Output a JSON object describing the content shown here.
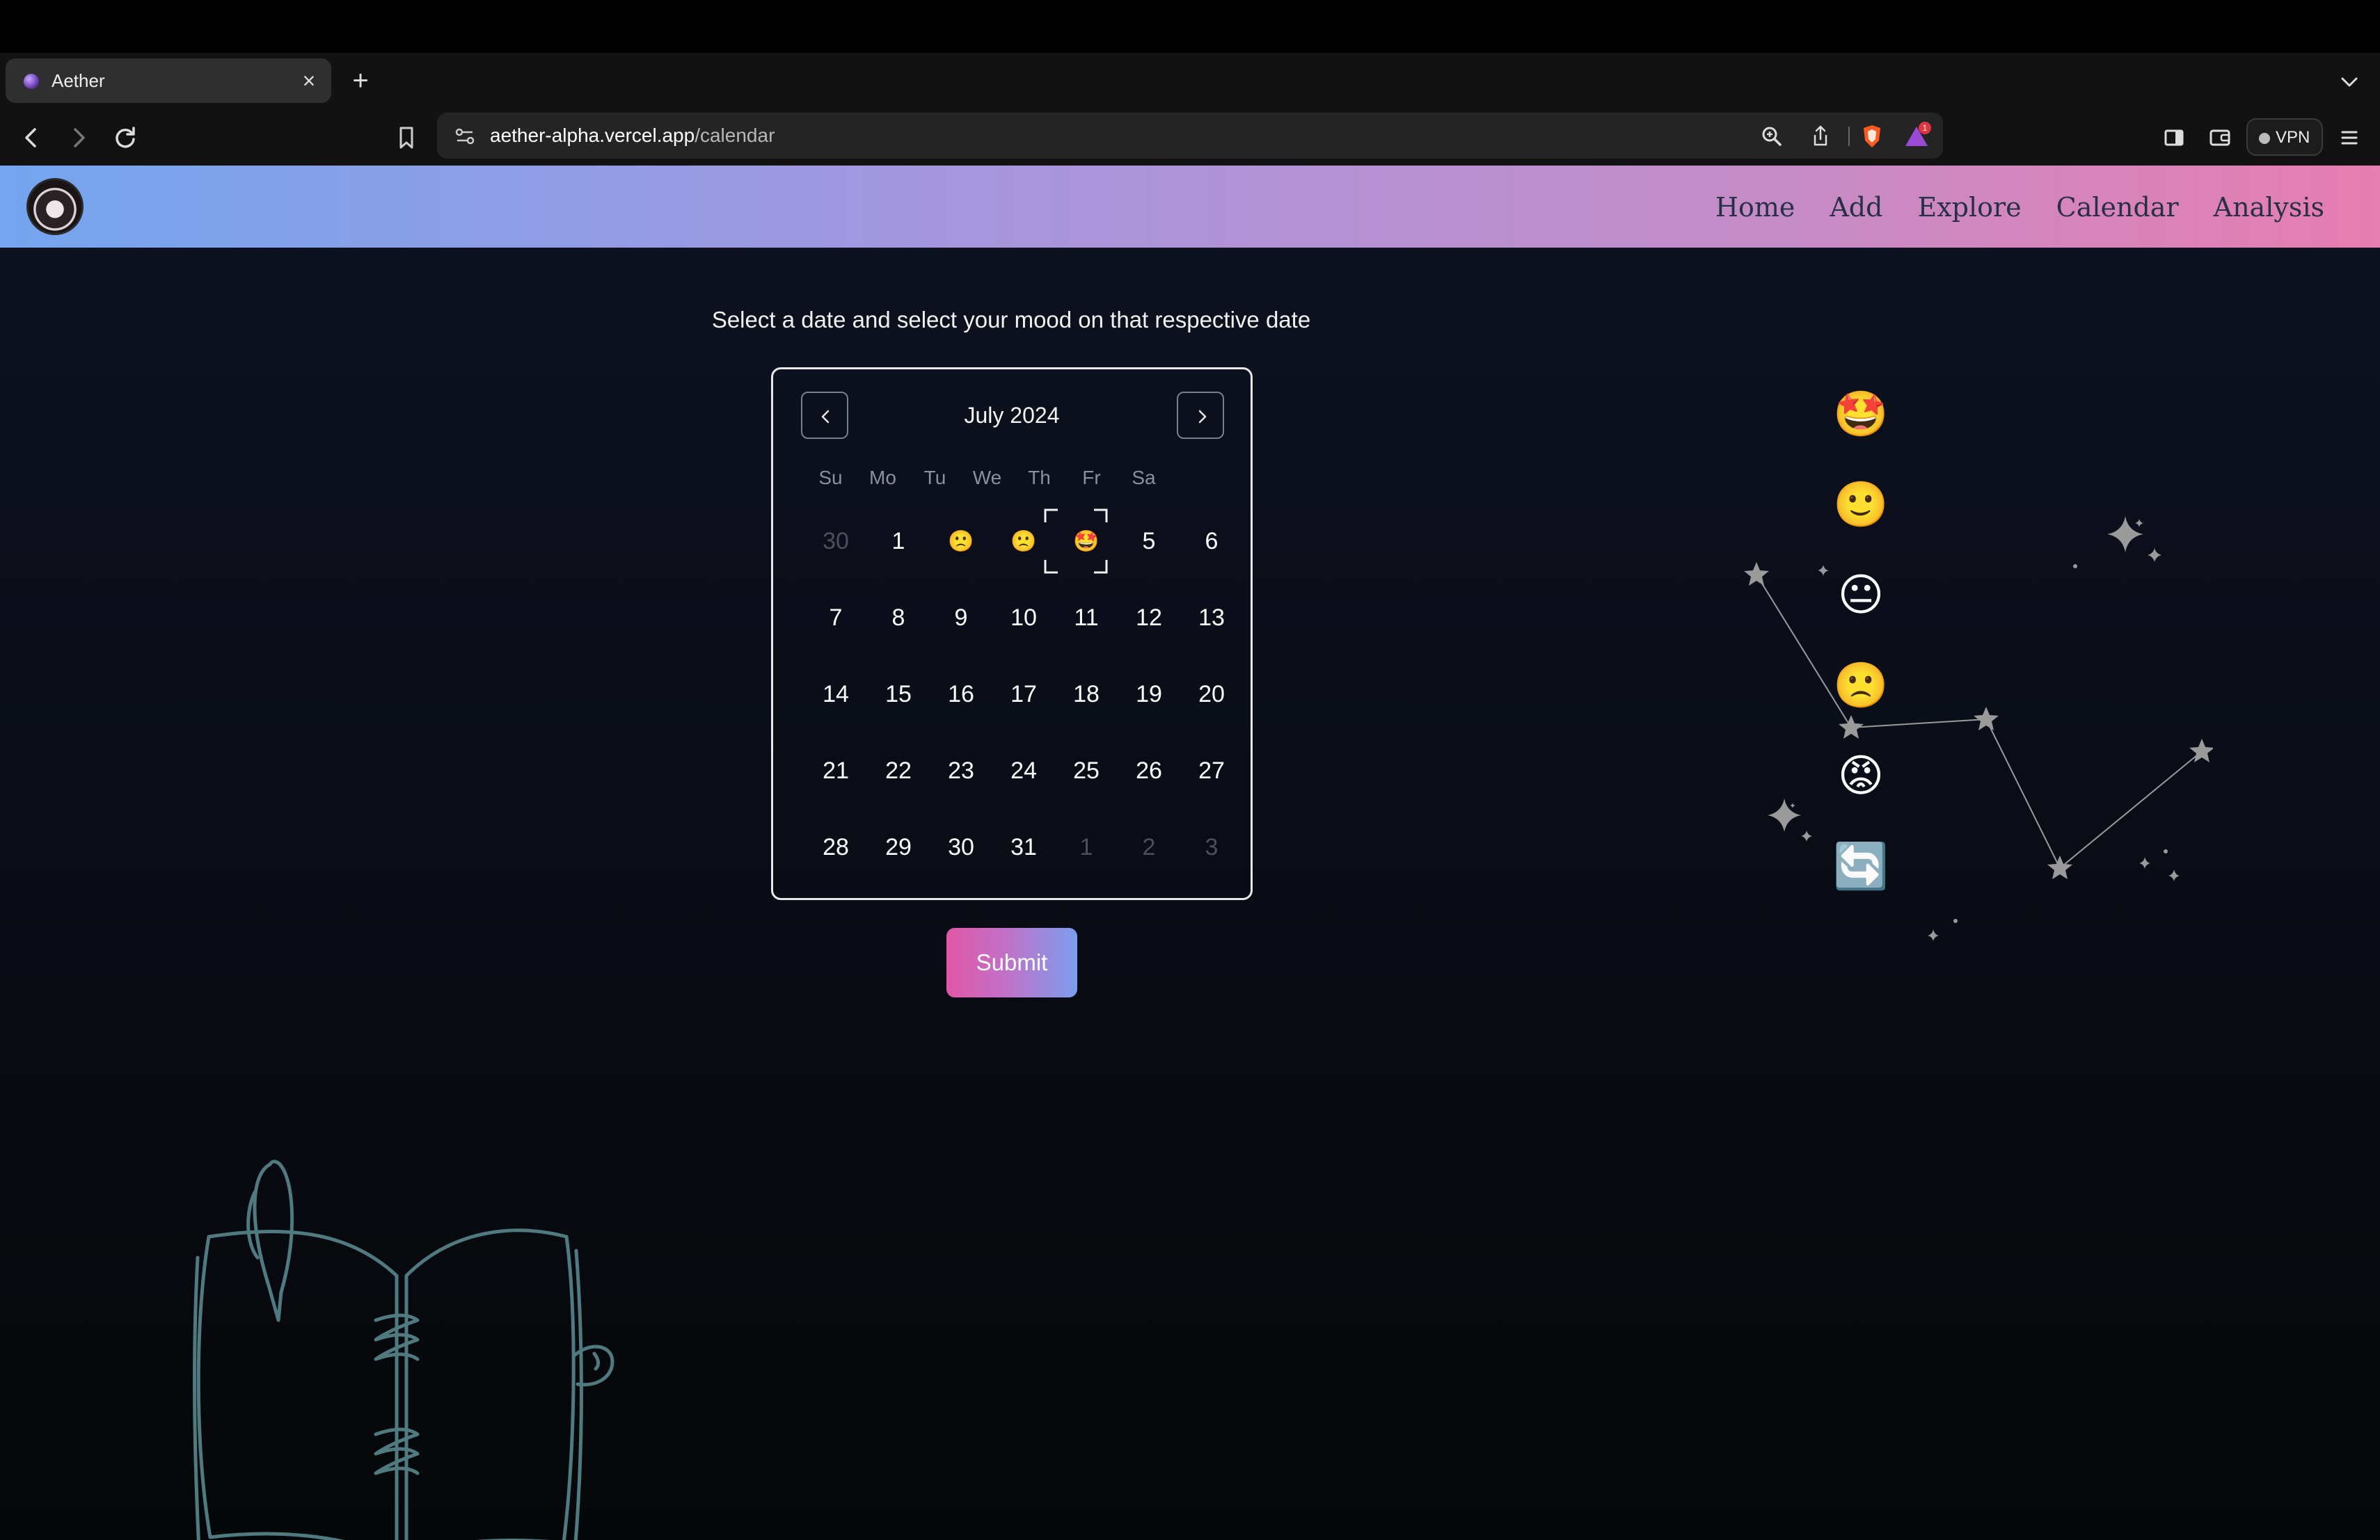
{
  "browser": {
    "tab_title": "Aether",
    "tab_close": "×",
    "new_tab": "+",
    "url_host": "aether-alpha.vercel.app",
    "url_path": "/calendar",
    "vpn_label": "VPN",
    "shield_badge": "1"
  },
  "site": {
    "nav": [
      "Home",
      "Add",
      "Explore",
      "Calendar",
      "Analysis"
    ],
    "instruction": "Select a date and select your mood on that respective date"
  },
  "calendar": {
    "month_label": "July 2024",
    "weekdays": [
      "Su",
      "Mo",
      "Tu",
      "We",
      "Th",
      "Fr",
      "Sa"
    ],
    "weeks": [
      [
        "30",
        "1",
        "🙁",
        "🙁",
        "🤩",
        "5",
        "6"
      ],
      [
        "7",
        "8",
        "9",
        "10",
        "11",
        "12",
        "13"
      ],
      [
        "14",
        "15",
        "16",
        "17",
        "18",
        "19",
        "20"
      ],
      [
        "21",
        "22",
        "23",
        "24",
        "25",
        "26",
        "27"
      ],
      [
        "28",
        "29",
        "30",
        "31",
        "1",
        "2",
        "3"
      ]
    ],
    "submit_label": "Submit"
  },
  "moods": [
    "🤩",
    "🙂",
    "😐",
    "🙁",
    "😡",
    "🔄"
  ],
  "colors": {
    "header_gradient_start": "#74a5ef",
    "header_gradient_end": "#e77db0",
    "submit_gradient_start": "#e257a6",
    "submit_gradient_end": "#7d9eef",
    "notebook_stroke": "#4e7a80"
  }
}
